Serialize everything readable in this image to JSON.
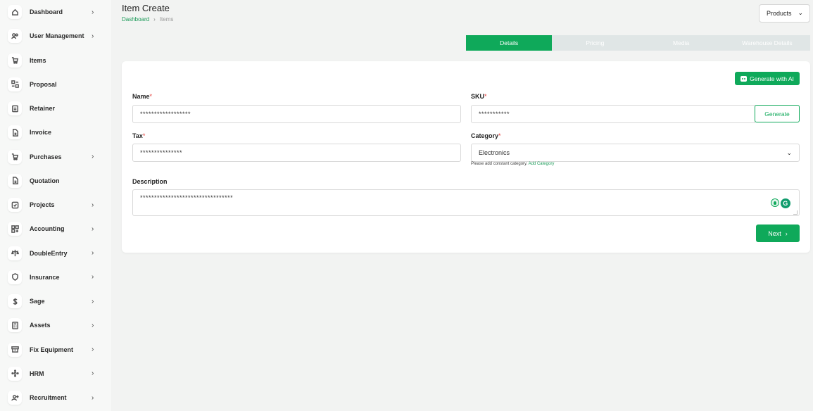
{
  "sidebar": {
    "items": [
      {
        "label": "Dashboard",
        "icon": "home-icon",
        "chevron": true
      },
      {
        "label": "User Management",
        "icon": "users-icon",
        "chevron": true
      },
      {
        "label": "Items",
        "icon": "cart-icon",
        "chevron": false
      },
      {
        "label": "Proposal",
        "icon": "proposal-icon",
        "chevron": false
      },
      {
        "label": "Retainer",
        "icon": "retainer-icon",
        "chevron": false
      },
      {
        "label": "Invoice",
        "icon": "file-icon",
        "chevron": false
      },
      {
        "label": "Purchases",
        "icon": "cart-icon",
        "chevron": true
      },
      {
        "label": "Quotation",
        "icon": "file-icon",
        "chevron": false
      },
      {
        "label": "Projects",
        "icon": "check-square-icon",
        "chevron": true
      },
      {
        "label": "Accounting",
        "icon": "grid-icon",
        "chevron": true
      },
      {
        "label": "DoubleEntry",
        "icon": "scale-icon",
        "chevron": true
      },
      {
        "label": "Insurance",
        "icon": "shield-icon",
        "chevron": true
      },
      {
        "label": "Sage",
        "icon": "dollar-icon",
        "chevron": true
      },
      {
        "label": "Assets",
        "icon": "calculator-icon",
        "chevron": true
      },
      {
        "label": "Fix Equipment",
        "icon": "archive-icon",
        "chevron": true
      },
      {
        "label": "HRM",
        "icon": "hrm-icon",
        "chevron": true
      },
      {
        "label": "Recruitment",
        "icon": "user-plus-icon",
        "chevron": true
      }
    ],
    "chevron_glyph": "›"
  },
  "header": {
    "title": "Item Create",
    "breadcrumb": {
      "home": "Dashboard",
      "sep": "›",
      "current": "Items"
    },
    "products_select": {
      "value": "Products",
      "chevron": "⌄"
    }
  },
  "tabs": [
    {
      "label": "Details",
      "active": true
    },
    {
      "label": "Pricing",
      "active": false
    },
    {
      "label": "Media",
      "active": false
    },
    {
      "label": "Warehouse Details",
      "active": false
    }
  ],
  "form": {
    "generate_ai_label": "Generate with AI",
    "name": {
      "label": "Name",
      "req": "*",
      "value": "******************"
    },
    "sku": {
      "label": "SKU",
      "req": "*",
      "value": "***********",
      "generate_label": "Generate"
    },
    "tax": {
      "label": "Tax",
      "req": "*",
      "value": "***************"
    },
    "category": {
      "label": "Category",
      "req": "*",
      "value": "Electronics",
      "chevron": "⌄",
      "hint": "Please add constant category.",
      "hint_link": "Add Category"
    },
    "description": {
      "label": "Description",
      "value": "*********************************"
    },
    "next_label": "Next",
    "next_chevron": "›"
  },
  "colors": {
    "accent": "#0fa95a",
    "required": "#e53935"
  }
}
